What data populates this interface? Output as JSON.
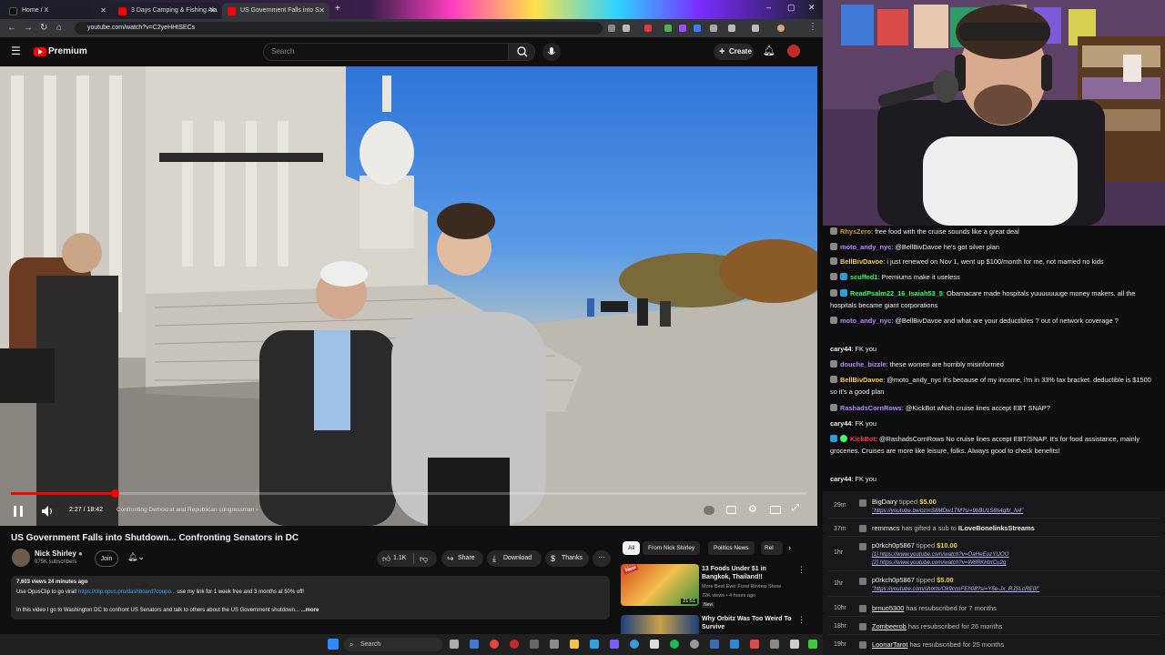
{
  "browser": {
    "tabs": [
      {
        "label": "Home / X",
        "favicon_color": "#111111",
        "active": false
      },
      {
        "label": "3 Days Camping & Fishing Ala",
        "favicon_color": "#ff0000",
        "active": false
      },
      {
        "label": "US Government Falls into S",
        "favicon_color": "#ff0000",
        "active": true
      }
    ],
    "url": "youtube.com/watch?v=C2yeHHtSECs"
  },
  "youtube": {
    "logo_text": "Premium",
    "search_placeholder": "Search",
    "create_label": "Create",
    "video": {
      "time_current": "2:27",
      "time_total": "18:42",
      "time_display": "2:27 / 18:42",
      "chapter": "Confronting Democrat and Republican congressman",
      "progress_fraction": 0.131
    },
    "title": "US Government Falls into Shutdown... Confronting Senators in DC",
    "channel": {
      "name": "Nick Shirley",
      "subscribers": "975K subscribers",
      "join_label": "Join"
    },
    "actions": {
      "likes": "1.1K",
      "share": "Share",
      "download": "Download",
      "thanks": "Thanks"
    },
    "description": {
      "stats": "7,603 views  24 minutes ago",
      "line1_a": "Use OpusClip to go viral!",
      "line1_link": "https://clip.opus.pro/dashboard?coupo...",
      "line1_b": "use my link for 1 week free and 3 months at 50% off!",
      "line2": "In this video I go to Washington DC to confront US Senators and talk to others about the US Government shutdown...",
      "more": "...more"
    },
    "chips": [
      "All",
      "From Nick Shirley",
      "Politics News",
      "Rel"
    ],
    "recommendations": [
      {
        "title": "13 Foods Under $1 in Bangkok, Thailand!!",
        "channel": "More Best Ever Food Review Show",
        "meta": "72K views • 4 hours ago",
        "badge": "New",
        "duration": "21:51"
      },
      {
        "title": "Why Orbitz Was Too Weird To Survive",
        "channel": "",
        "meta": "",
        "badge": "",
        "duration": ""
      }
    ]
  },
  "taskbar": {
    "search_label": "Search"
  },
  "chat": {
    "messages": [
      {
        "user": "RhysZero",
        "color": "#c9a227",
        "text": "free food with the cruise sounds like a great deal"
      },
      {
        "user": "moto_andy_nyc",
        "color": "#b98cff",
        "text": "@BellBivDavoe he's got silver plan"
      },
      {
        "user": "BellBivDavoe",
        "color": "#ffd23f",
        "text": "i just renewed on Nov 1, went up $100/month for me, not married no kids"
      },
      {
        "user": "scuffed1",
        "color": "#3dfc6a",
        "text": "Premiums make it useless"
      },
      {
        "user": "ReadPsalm22_16_Isaiah53_5",
        "color": "#3dfc6a",
        "text": "Obamacare made hospitals yuuuuuuuge money makers. all the hospitals became giant corporations"
      },
      {
        "user": "moto_andy_nyc",
        "color": "#b98cff",
        "text": "@BellBivDavoe and what are your deductibles ? out of network coverage ?"
      },
      {
        "user": "cary44",
        "color": "#efeff1",
        "text": "FK you"
      },
      {
        "user": "douche_bizzle",
        "color": "#b98cff",
        "text": "these women are horribly misinformed"
      },
      {
        "user": "BellBivDavoe",
        "color": "#ffd23f",
        "text": "@moto_andy_nyc it's because of my income, i'm in 33% tax bracket. deductible is $1500 so it's a good plan"
      },
      {
        "user": "RashadsCornRows",
        "color": "#b98cff",
        "text": "@KickBot which cruise lines accept EBT SNAP?"
      },
      {
        "user": "cary44",
        "color": "#efeff1",
        "text": "FK you"
      },
      {
        "user": "KickBot",
        "color": "#ff3b3b",
        "text": "@RashadsCornRows No cruise lines accept EBT/SNAP. It's for food assistance, mainly groceries. Cruises are more like leisure, folks. Always good to check benefits!"
      },
      {
        "user": "cary44",
        "color": "#efeff1",
        "text": "FK you"
      }
    ]
  },
  "events": [
    {
      "time": "29m",
      "user": "BigDairy",
      "action": "tipped",
      "amount": "$5.00",
      "sub": [
        "\"https://youtube.be/ozmS8MDw1TM?si=9bBU1S8h4gftr_N4\""
      ]
    },
    {
      "time": "37m",
      "user": "remmacs",
      "action": "has gifted a sub to",
      "amount": "ILoveBonelinksStreams",
      "sub": []
    },
    {
      "time": "1hr",
      "user": "p0rkch0p5867",
      "action": "tipped",
      "amount": "$10.00",
      "sub": [
        "[1] https://www.youtube.com/watch?v=OaHeEozYUOO",
        "[2] https://www.youtube.com/watch?v=W8RKHztCu2g"
      ]
    },
    {
      "time": "1hr",
      "user": "p0rkch0p5867",
      "action": "tipped",
      "amount": "$5.00",
      "sub": [
        "\"https://youtube.com/shorts/Ok9ccnFEh08?si=Y5e-Jx_RJSLcRE0I\""
      ]
    },
    {
      "time": "10hr",
      "user": "brnuo5300",
      "action": "has resubscribed for 7 months",
      "amount": "",
      "sub": []
    },
    {
      "time": "18hr",
      "user": "Zombeerob",
      "action": "has resubscribed for 26 months",
      "amount": "",
      "sub": []
    },
    {
      "time": "19hr",
      "user": "LoonarTarot",
      "action": "has resubscribed for 25 months",
      "amount": "",
      "sub": []
    }
  ]
}
